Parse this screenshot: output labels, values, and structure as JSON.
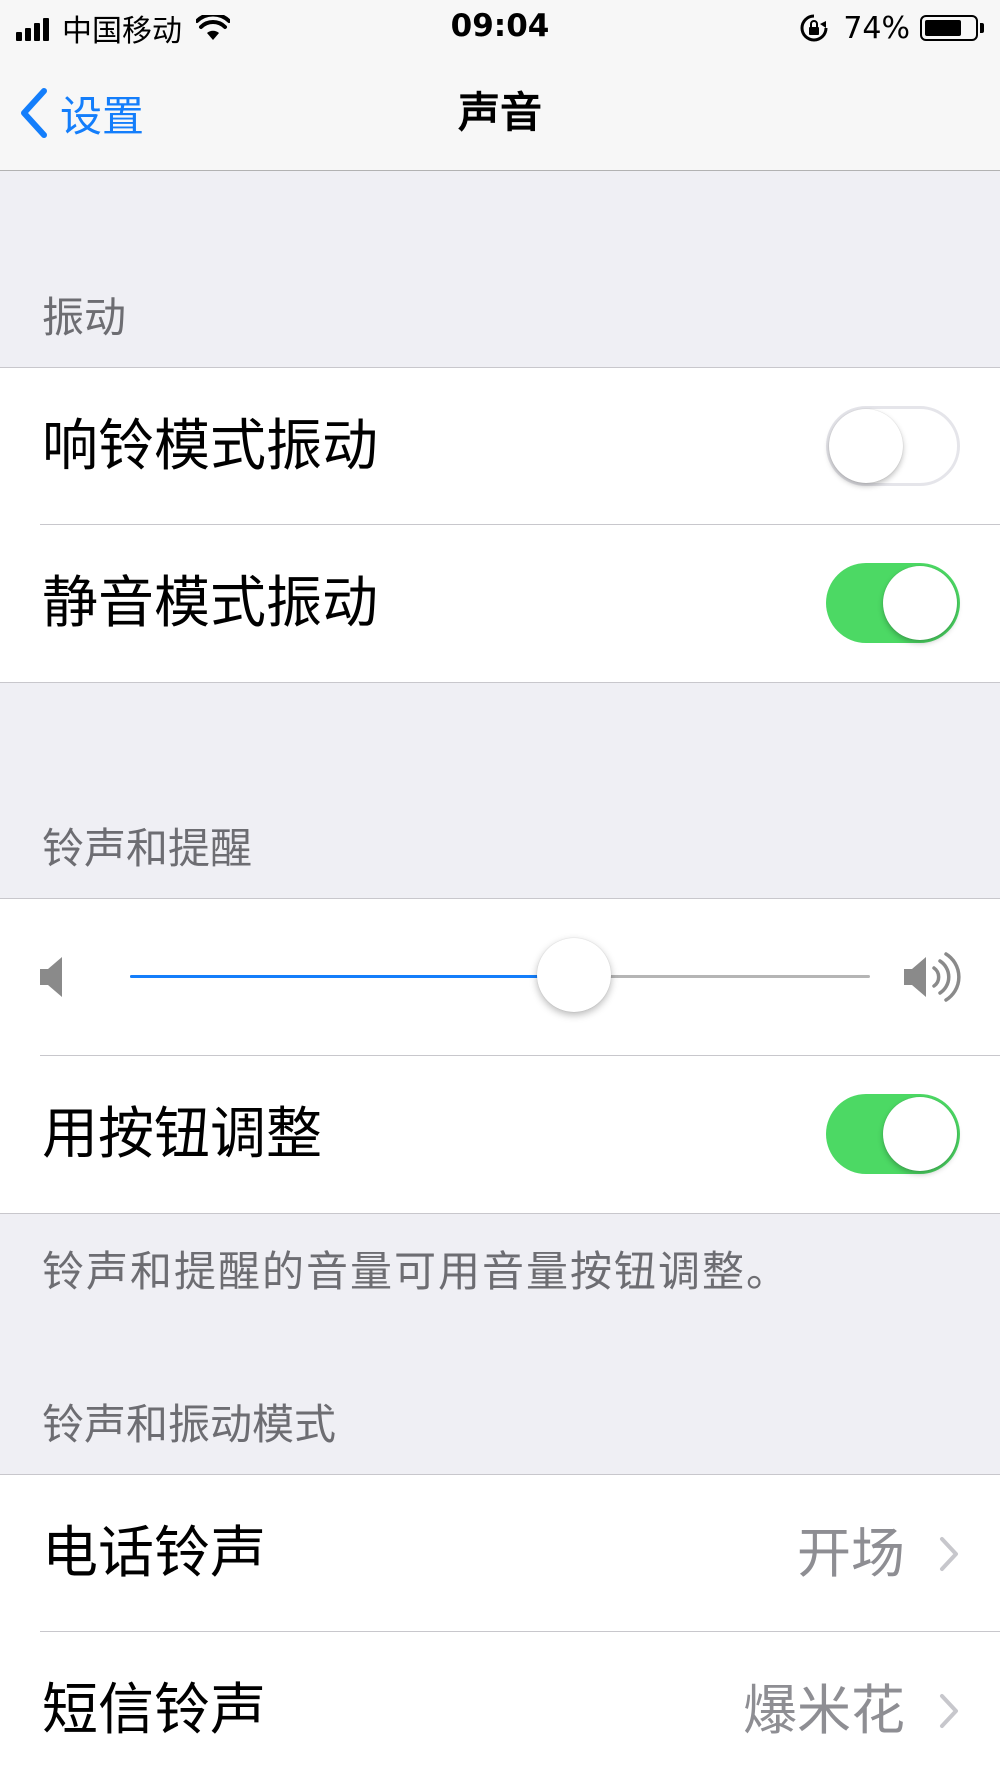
{
  "status_bar": {
    "carrier": "中国移动",
    "time": "09:04",
    "battery_percent": "74%",
    "battery_level": 0.74
  },
  "nav": {
    "back_label": "设置",
    "title": "声音"
  },
  "sections": {
    "vibrate": {
      "header": "振动",
      "rows": [
        {
          "label": "响铃模式振动",
          "toggle_on": false
        },
        {
          "label": "静音模式振动",
          "toggle_on": true
        }
      ]
    },
    "ringer_alerts": {
      "header": "铃声和提醒",
      "volume_level": 0.6,
      "change_with_buttons": {
        "label": "用按钮调整",
        "toggle_on": true
      },
      "footer": "铃声和提醒的音量可用音量按钮调整。"
    },
    "sounds_patterns": {
      "header": "铃声和振动模式",
      "rows": [
        {
          "label": "电话铃声",
          "value": "开场"
        },
        {
          "label": "短信铃声",
          "value": "爆米花"
        }
      ]
    }
  },
  "colors": {
    "accent": "#147efb",
    "toggle_on": "#4cd964",
    "background": "#efeff4"
  }
}
